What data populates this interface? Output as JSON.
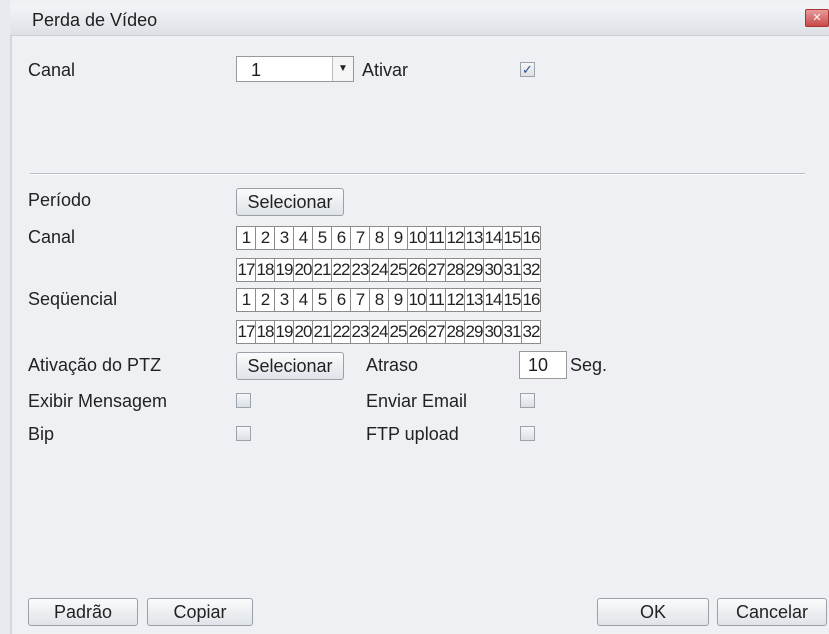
{
  "window": {
    "title": "Perda de Vídeo",
    "close_label": "✕"
  },
  "top": {
    "canal_label": "Canal",
    "canal_value": "1",
    "ativar_label": "Ativar",
    "ativar_checked": true
  },
  "form": {
    "periodo_label": "Período",
    "periodo_button": "Selecionar",
    "canal_label": "Canal",
    "sequencial_label": "Seqüencial",
    "ptz_label": "Ativação do PTZ",
    "ptz_button": "Selecionar",
    "atraso_label": "Atraso",
    "atraso_value": "10",
    "atraso_unit": "Seg.",
    "exibir_label": "Exibir Mensagem",
    "email_label": "Enviar Email",
    "bip_label": "Bip",
    "ftp_label": "FTP upload"
  },
  "channels_row1": [
    "1",
    "2",
    "3",
    "4",
    "5",
    "6",
    "7",
    "8",
    "9",
    "10",
    "11",
    "12",
    "13",
    "14",
    "15",
    "16"
  ],
  "channels_row2": [
    "17",
    "18",
    "19",
    "20",
    "21",
    "22",
    "23",
    "24",
    "25",
    "26",
    "27",
    "28",
    "29",
    "30",
    "31",
    "32"
  ],
  "footer": {
    "padrao": "Padrão",
    "copiar": "Copiar",
    "ok": "OK",
    "cancelar": "Cancelar"
  },
  "colors": {
    "background": "#eef0f3",
    "check": "#2e4e8a",
    "close": "#c84a4a"
  }
}
